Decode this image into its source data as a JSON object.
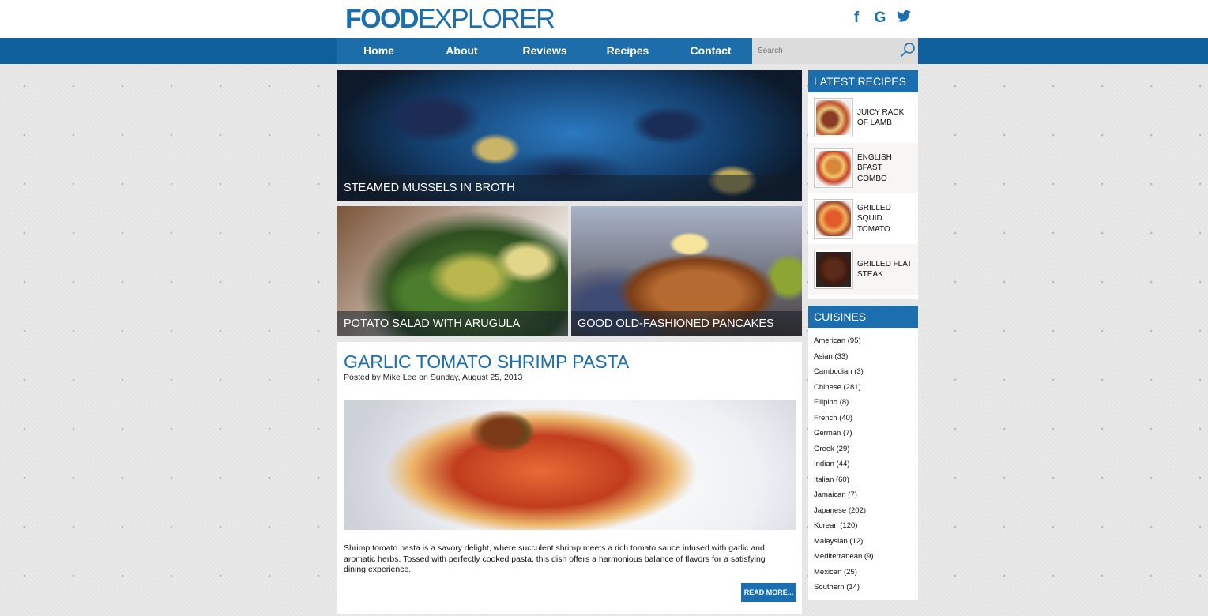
{
  "header": {
    "logo_bold": "FOOD",
    "logo_light": "EXPLORER",
    "social": [
      {
        "icon": "facebook-icon",
        "glyph": "f"
      },
      {
        "icon": "google-icon",
        "glyph": "G"
      },
      {
        "icon": "twitter-icon",
        "glyph": "t"
      }
    ]
  },
  "nav": {
    "items": [
      "Home",
      "About",
      "Reviews",
      "Recipes",
      "Contact"
    ],
    "search_placeholder": "Search"
  },
  "featured": {
    "main": {
      "title": "STEAMED MUSSELS IN BROTH"
    },
    "left": {
      "title": "POTATO SALAD WITH ARUGULA"
    },
    "right": {
      "title": "GOOD OLD-FASHIONED PANCAKES"
    }
  },
  "post": {
    "title": "GARLIC TOMATO SHRIMP PASTA",
    "meta": "Posted by Mike Lee on Sunday, August 25, 2013",
    "body": "Shrimp tomato pasta is a savory delight, where succulent shrimp meets a rich tomato sauce infused with garlic and aromatic herbs. Tossed with perfectly cooked pasta, this dish offers a harmonious balance of flavors for a satisfying dining experience.",
    "read_more": "READ MORE..."
  },
  "sidebar": {
    "latest_title": "LATEST RECIPES",
    "latest": [
      {
        "label": "JUICY RACK OF LAMB"
      },
      {
        "label": "ENGLISH BFAST COMBO"
      },
      {
        "label": "GRILLED SQUID TOMATO"
      },
      {
        "label": "GRILLED FLAT STEAK"
      }
    ],
    "cuisines_title": "CUISINES",
    "cuisines": [
      "American (95)",
      "Asian (33)",
      "Cambodian (3)",
      "Chinese (281)",
      "Filipino (8)",
      "French (40)",
      "German (7)",
      "Greek (29)",
      "Indian (44)",
      "Italian (60)",
      "Jamaican (7)",
      "Japanese (202)",
      "Korean (120)",
      "Malaysian (12)",
      "Mediterranean (9)",
      "Mexican (25)",
      "Southern (14)"
    ]
  },
  "colors": {
    "brand_blue": "#1c6fae",
    "nav_dark": "#0f5f9c"
  }
}
